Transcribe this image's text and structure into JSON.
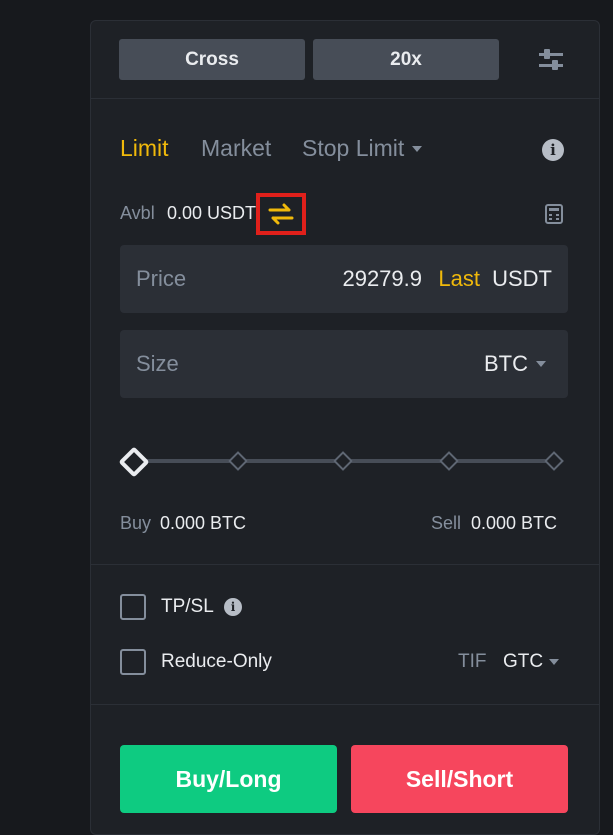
{
  "margin": {
    "mode": "Cross",
    "leverage": "20x"
  },
  "order_tabs": [
    {
      "label": "Limit",
      "active": true
    },
    {
      "label": "Market",
      "active": false
    },
    {
      "label": "Stop Limit",
      "active": false
    }
  ],
  "avbl": {
    "label": "Avbl",
    "value": "0.00 USDT"
  },
  "price": {
    "label": "Price",
    "value": "29279.9",
    "last": "Last",
    "unit": "USDT"
  },
  "size": {
    "label": "Size",
    "unit": "BTC"
  },
  "slider": {
    "value_percent": 0
  },
  "amounts": {
    "buy_label": "Buy",
    "buy_value": "0.000 BTC",
    "sell_label": "Sell",
    "sell_value": "0.000 BTC"
  },
  "options": {
    "tpsl_label": "TP/SL",
    "tpsl_checked": false,
    "reduce_only_label": "Reduce-Only",
    "reduce_only_checked": false,
    "tif_label": "TIF",
    "tif_value": "GTC"
  },
  "actions": {
    "buy": "Buy/Long",
    "sell": "Sell/Short"
  },
  "colors": {
    "accent": "#f0b90b",
    "buy": "#0ecb81",
    "sell": "#f6465d",
    "highlight_box": "#e0201b",
    "panel": "#1e2126",
    "field": "#2b2f36"
  },
  "icons": {
    "settings": "sliders-icon",
    "info": "info-icon",
    "transfer": "transfer-arrows-icon",
    "calculator": "calculator-icon"
  }
}
